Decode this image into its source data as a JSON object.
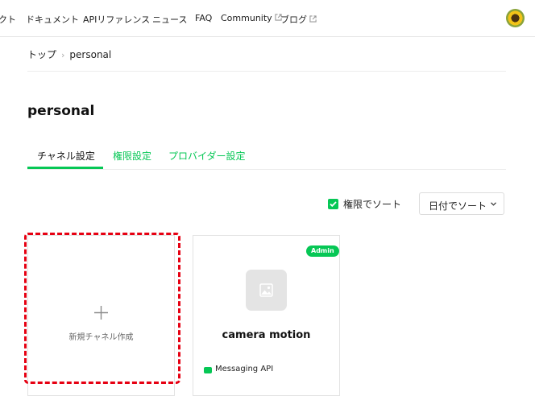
{
  "nav": {
    "items": [
      {
        "label": "クト",
        "external": false
      },
      {
        "label": "ドキュメント",
        "external": false
      },
      {
        "label": "APIリファレンス",
        "external": false
      },
      {
        "label": "ニュース",
        "external": false
      },
      {
        "label": "FAQ",
        "external": false
      },
      {
        "label": "Community",
        "external": true
      },
      {
        "label": "ブログ",
        "external": true
      }
    ]
  },
  "breadcrumb": {
    "home": "トップ",
    "separator": "›",
    "current": "personal"
  },
  "page_title": "personal",
  "tabs": [
    {
      "label": "チャネル設定",
      "active": true
    },
    {
      "label": "権限設定",
      "active": false
    },
    {
      "label": "プロバイダー設定",
      "active": false
    }
  ],
  "sort": {
    "checkbox_label": "権限でソート",
    "checked": true,
    "select_value": "日付でソート"
  },
  "cards": {
    "new_channel": {
      "label": "新規チャネル作成"
    },
    "channel": {
      "badge": "Admin",
      "name": "camera motion",
      "type": "Messaging API"
    }
  },
  "colors": {
    "accent": "#06c755",
    "highlight": "#e60012"
  }
}
